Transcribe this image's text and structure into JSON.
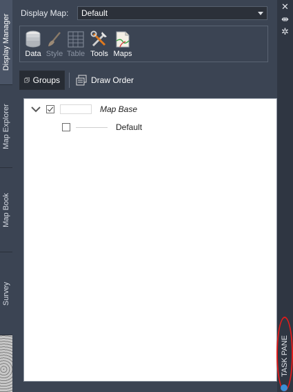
{
  "left_tabs": [
    {
      "label": "Display Manager",
      "active": true
    },
    {
      "label": "Map Explorer",
      "active": false
    },
    {
      "label": "Map Book",
      "active": false
    },
    {
      "label": "Survey",
      "active": false
    }
  ],
  "header": {
    "display_map_label": "Display Map:",
    "display_map_value": "Default"
  },
  "toolbar": {
    "data": "Data",
    "style": "Style",
    "table": "Table",
    "tools": "Tools",
    "maps": "Maps"
  },
  "tabs": {
    "groups": "Groups",
    "draw_order": "Draw Order"
  },
  "tree": {
    "group_label": "Map Base",
    "group_checked": true,
    "layer_label": "Default",
    "layer_checked": false
  },
  "right_strip": {
    "close_icon": "✕",
    "autohide_icon": "⇼",
    "properties_icon": "✲",
    "task_pane_label": "TASK PANE"
  },
  "colors": {
    "panel_bg": "#3b4453",
    "tree_bg": "#ffffff",
    "highlight": "#e21b1b"
  }
}
